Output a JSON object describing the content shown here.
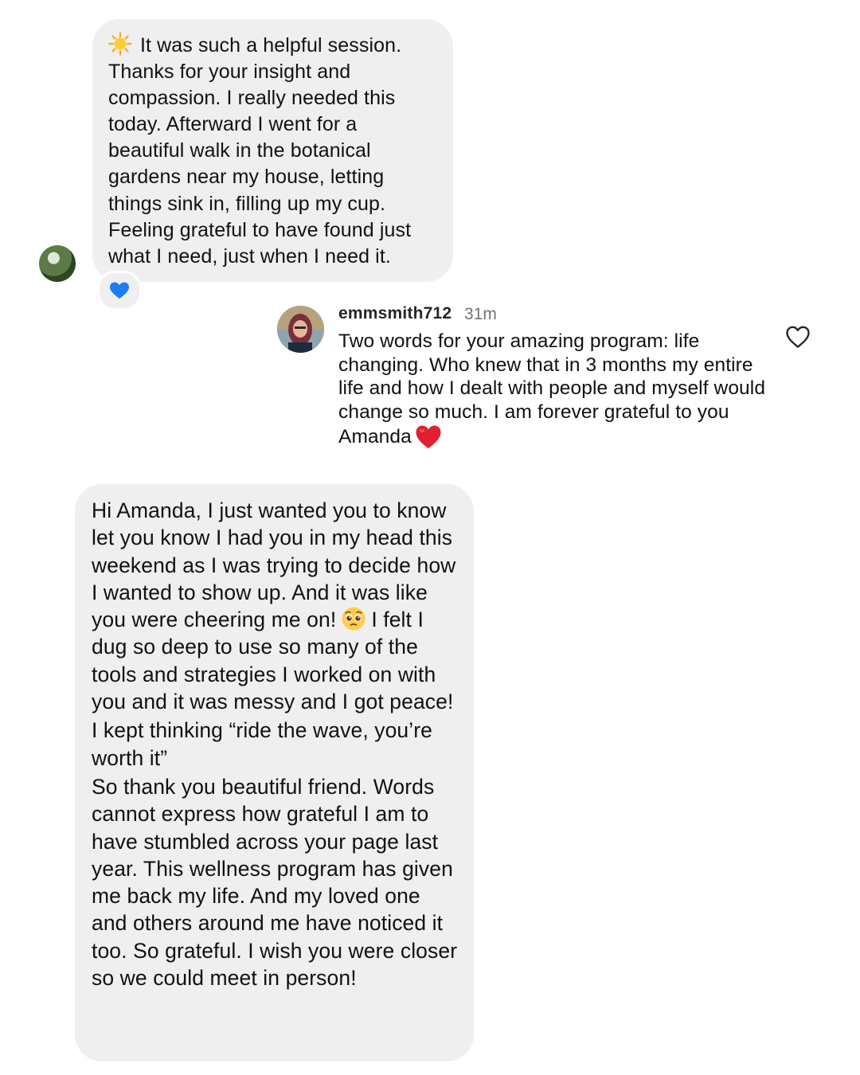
{
  "messages": {
    "first": {
      "text": "It was such a helpful session. Thanks for your insight and compassion. I really needed this today. Afterward I went for a beautiful walk in the botanical gardens near my house, letting things sink in, filling up my cup. Feeling grateful to have found just what I need, just when I need it.",
      "leading_icon": "sun-emoji",
      "reaction": "blue-heart-emoji"
    },
    "comment": {
      "username": "emmsmith712",
      "time": "31m",
      "text": "Two words for your amazing program: life changing. Who knew that in 3 months my entire life and how I dealt with people and myself would change so much. I am forever grateful to you Amanda",
      "trailing_icon": "red-heart-emoji"
    },
    "second": {
      "p1_before": "Hi Amanda, I just wanted you to know let you know I had you in my head this weekend as I was trying to decide how I wanted to show up. And it was like you were cheering me on!",
      "p1_icon": "pleading-face-emoji",
      "p1_after": "I felt I dug so deep to use so many of the tools and strategies I worked on with you and it was messy and I got peace!",
      "p2": "I kept thinking “ride the wave, you’re worth it”",
      "p3": "So thank you beautiful friend. Words cannot express how grateful I am to have stumbled across your page last year.  This wellness program has given me back my life.  And my loved one and others around me have noticed it too.  So grateful.  I wish you were closer so we could meet in person!"
    }
  },
  "colors": {
    "bubble": "#efefef",
    "text": "#111111",
    "muted": "#737373",
    "blue_heart": "#1d7cf2",
    "red_heart": "#e0202e"
  }
}
